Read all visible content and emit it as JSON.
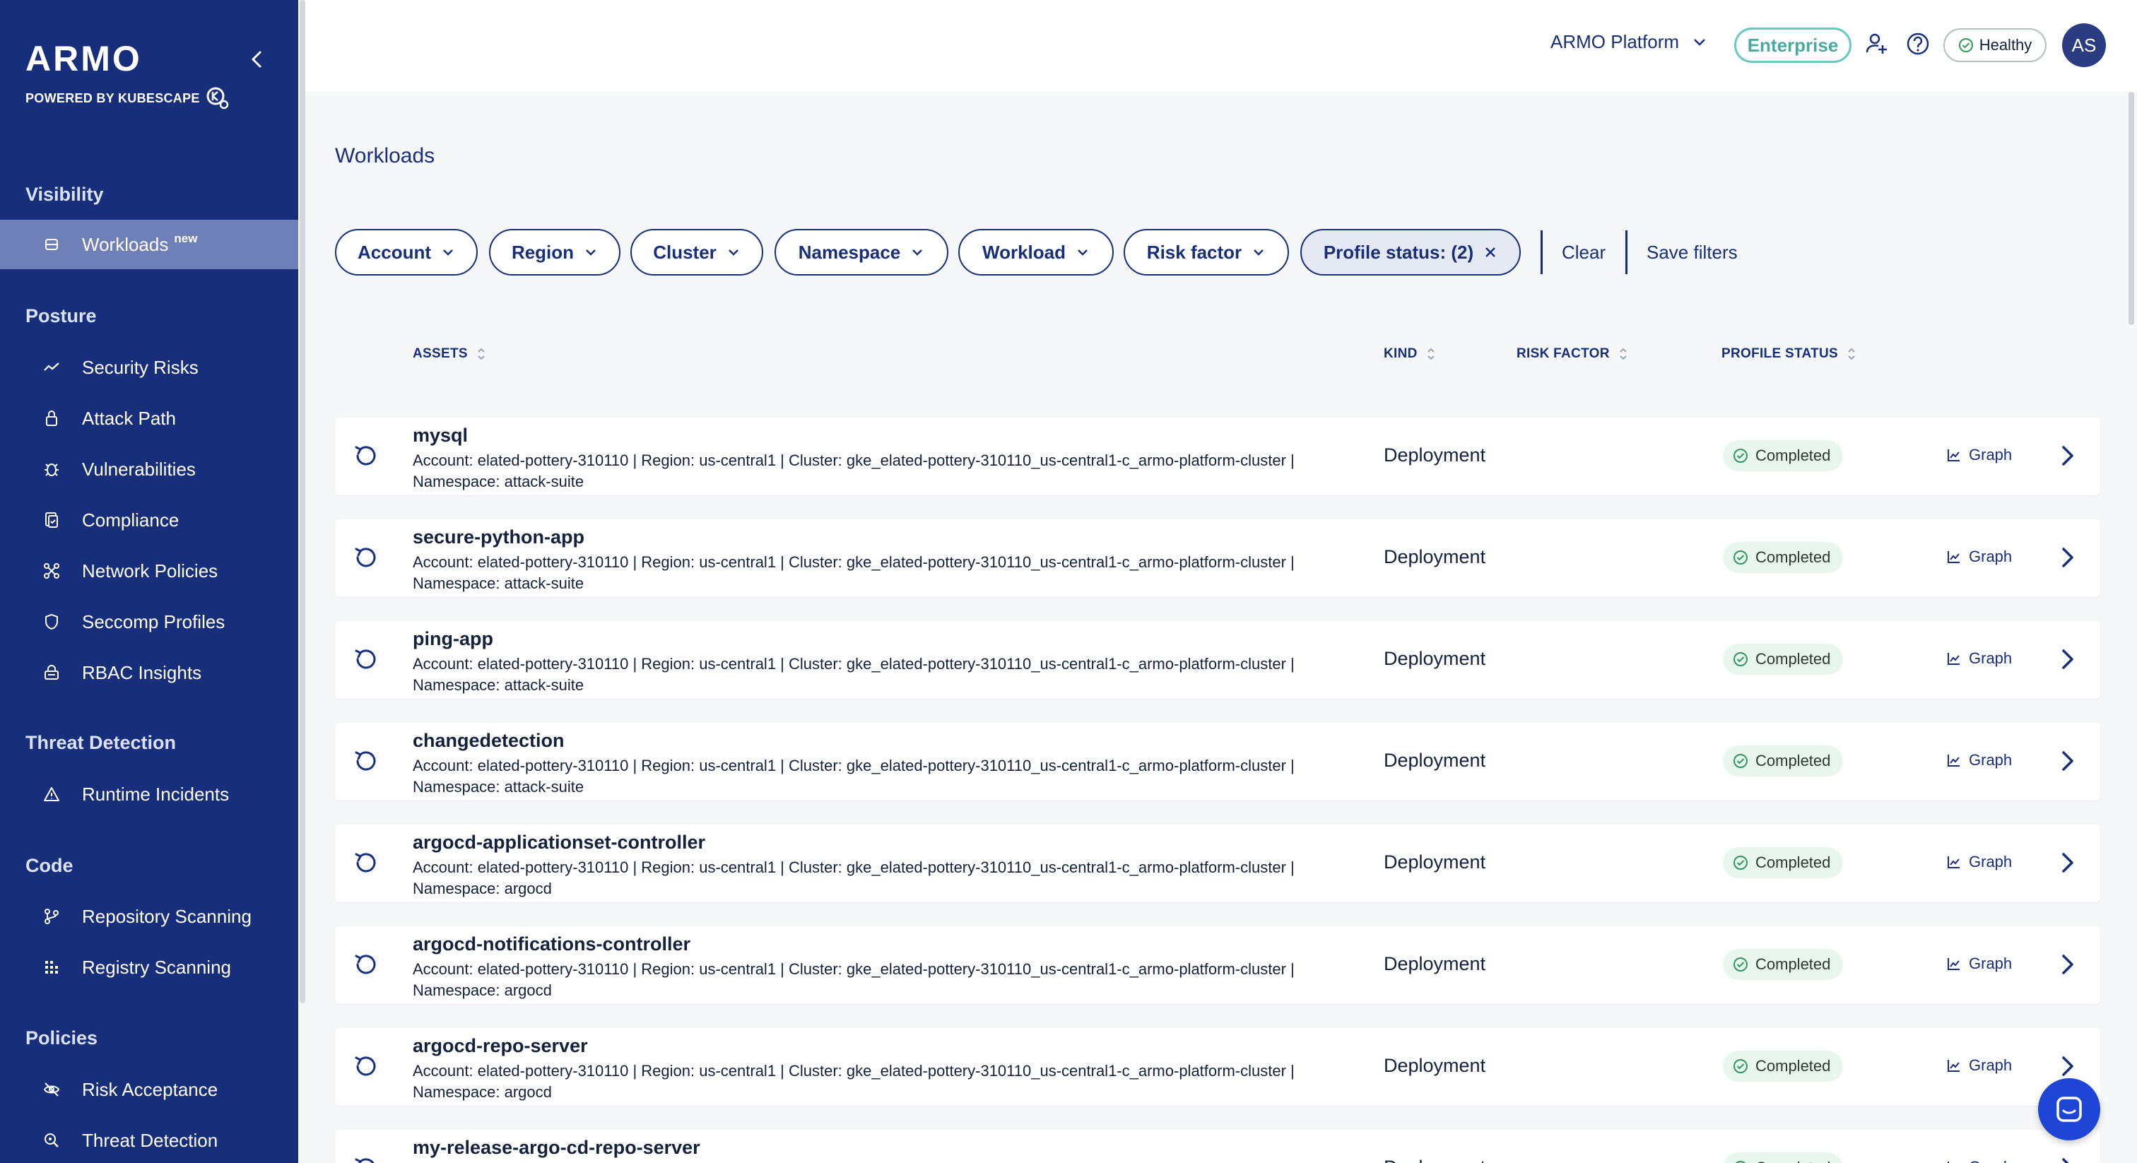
{
  "brand": {
    "logo": "ARMO",
    "sub": "POWERED BY KUBESCAPE"
  },
  "sidebar": {
    "sections": [
      {
        "title": "Visibility",
        "items": [
          {
            "label": "Workloads",
            "badge": "new",
            "icon": "workloads-icon",
            "active": true
          }
        ]
      },
      {
        "title": "Posture",
        "items": [
          {
            "label": "Security Risks",
            "icon": "trend-icon"
          },
          {
            "label": "Attack Path",
            "icon": "attack-path-icon"
          },
          {
            "label": "Vulnerabilities",
            "icon": "bug-icon"
          },
          {
            "label": "Compliance",
            "icon": "compliance-icon"
          },
          {
            "label": "Network Policies",
            "icon": "network-icon"
          },
          {
            "label": "Seccomp Profiles",
            "icon": "shield-icon"
          },
          {
            "label": "RBAC Insights",
            "icon": "rbac-icon"
          }
        ]
      },
      {
        "title": "Threat Detection",
        "items": [
          {
            "label": "Runtime Incidents",
            "icon": "warning-icon"
          }
        ]
      },
      {
        "title": "Code",
        "items": [
          {
            "label": "Repository Scanning",
            "icon": "git-icon"
          },
          {
            "label": "Registry Scanning",
            "icon": "registry-icon"
          }
        ]
      },
      {
        "title": "Policies",
        "items": [
          {
            "label": "Risk Acceptance",
            "icon": "eye-off-icon"
          },
          {
            "label": "Threat Detection",
            "icon": "search-icon"
          }
        ]
      }
    ]
  },
  "header": {
    "org": "ARMO Platform",
    "plan": "Enterprise",
    "health": "Healthy",
    "avatar": "AS"
  },
  "page": {
    "title": "Workloads"
  },
  "filters": {
    "items": [
      "Account",
      "Region",
      "Cluster",
      "Namespace",
      "Workload",
      "Risk factor"
    ],
    "profile_status": "Profile status: (2)",
    "clear": "Clear",
    "save": "Save filters"
  },
  "table": {
    "columns": {
      "assets": "ASSETS",
      "kind": "KIND",
      "risk": "RISK FACTOR",
      "status": "PROFILE STATUS"
    },
    "graph_label": "Graph",
    "rows": [
      {
        "name": "mysql",
        "meta1": "Account: elated-pottery-310110 | Region: us-central1 | Cluster: gke_elated-pottery-310110_us-central1-c_armo-platform-cluster |",
        "meta2": "Namespace: attack-suite",
        "kind": "Deployment",
        "status": "Completed"
      },
      {
        "name": "secure-python-app",
        "meta1": "Account: elated-pottery-310110 | Region: us-central1 | Cluster: gke_elated-pottery-310110_us-central1-c_armo-platform-cluster |",
        "meta2": "Namespace: attack-suite",
        "kind": "Deployment",
        "status": "Completed"
      },
      {
        "name": "ping-app",
        "meta1": "Account: elated-pottery-310110 | Region: us-central1 | Cluster: gke_elated-pottery-310110_us-central1-c_armo-platform-cluster |",
        "meta2": "Namespace: attack-suite",
        "kind": "Deployment",
        "status": "Completed"
      },
      {
        "name": "changedetection",
        "meta1": "Account: elated-pottery-310110 | Region: us-central1 | Cluster: gke_elated-pottery-310110_us-central1-c_armo-platform-cluster |",
        "meta2": "Namespace: attack-suite",
        "kind": "Deployment",
        "status": "Completed"
      },
      {
        "name": "argocd-applicationset-controller",
        "meta1": "Account: elated-pottery-310110 | Region: us-central1 | Cluster: gke_elated-pottery-310110_us-central1-c_armo-platform-cluster |",
        "meta2": "Namespace: argocd",
        "kind": "Deployment",
        "status": "Completed"
      },
      {
        "name": "argocd-notifications-controller",
        "meta1": "Account: elated-pottery-310110 | Region: us-central1 | Cluster: gke_elated-pottery-310110_us-central1-c_armo-platform-cluster |",
        "meta2": "Namespace: argocd",
        "kind": "Deployment",
        "status": "Completed"
      },
      {
        "name": "argocd-repo-server",
        "meta1": "Account: elated-pottery-310110 | Region: us-central1 | Cluster: gke_elated-pottery-310110_us-central1-c_armo-platform-cluster |",
        "meta2": "Namespace: argocd",
        "kind": "Deployment",
        "status": "Completed"
      },
      {
        "name": "my-release-argo-cd-repo-server",
        "meta1": "",
        "meta2": "",
        "kind": "Deployment",
        "status": "Completed"
      }
    ]
  },
  "colors": {
    "sidebar": "#172f7a",
    "active": "#6f7fb7",
    "accent": "#67c9c0",
    "success_bg": "#e9f6ee"
  }
}
